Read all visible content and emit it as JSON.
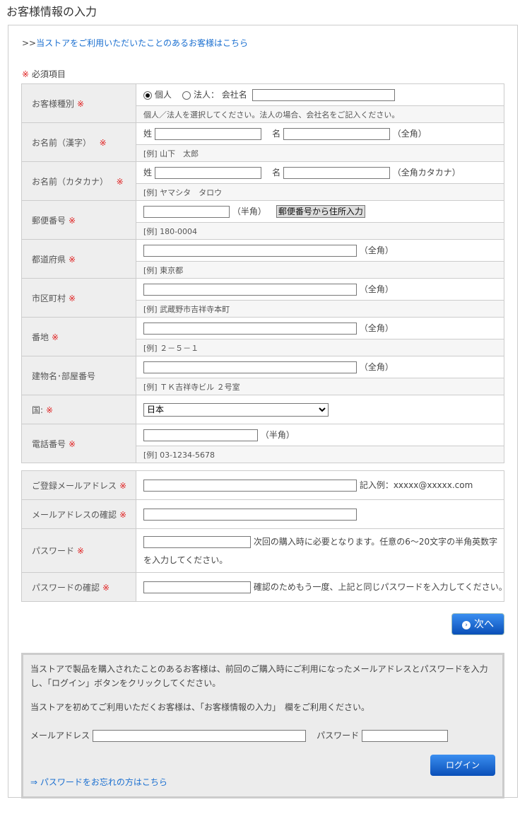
{
  "page_title": "お客様情報の入力",
  "returning_link_prefix": ">>",
  "returning_link": "当ストアをご利用いただいたことのあるお客様はこちら",
  "required_mark": "※",
  "required_note": "必須項目",
  "customer_form": {
    "type": {
      "label": "お客様種別",
      "opt_individual": "個人",
      "opt_corporate": "法人：",
      "company_label": "会社名",
      "hint": "個人／法人を選択してください。法人の場合、会社名をご記入ください。"
    },
    "name_kanji": {
      "label": "お名前（漢字）",
      "last": "姓",
      "first": "名",
      "note": "（全角）",
      "example": "[例] 山下　太郎"
    },
    "name_kana": {
      "label": "お名前（カタカナ）",
      "last": "姓",
      "first": "名",
      "note": "（全角カタカナ）",
      "example": "[例] ヤマシタ　タロウ"
    },
    "zip": {
      "label": "郵便番号",
      "note": "（半角）",
      "button": "郵便番号から住所入力",
      "example": "[例] 180-0004"
    },
    "prefecture": {
      "label": "都道府県",
      "note": "（全角）",
      "example": "[例] 東京都"
    },
    "city": {
      "label": "市区町村",
      "note": "（全角）",
      "example": "[例] 武蔵野市吉祥寺本町"
    },
    "street": {
      "label": "番地",
      "note": "（全角）",
      "example": "[例] ２－５－１"
    },
    "building": {
      "label": "建物名･部屋番号",
      "note": "（全角）",
      "example": "[例] ＴＫ吉祥寺ビル ２号室"
    },
    "country": {
      "label": "国:",
      "selected": "日本"
    },
    "phone": {
      "label": "電話番号",
      "note": "（半角）",
      "example": "[例] 03-1234-5678"
    }
  },
  "account_form": {
    "email": {
      "label": "ご登録メールアドレス",
      "note": "記入例：xxxxx@xxxxx.com"
    },
    "email_confirm": {
      "label": "メールアドレスの確認"
    },
    "password": {
      "label": "パスワード",
      "note": "次回の購入時に必要となります。任意の6～20文字の半角英数字を入力してください。"
    },
    "password_confirm": {
      "label": "パスワードの確認",
      "note": "確認のためもう一度、上記と同じパスワードを入力してください。"
    }
  },
  "next_button": "次へ",
  "login_box": {
    "text1": "当ストアで製品を購入されたことのあるお客様は、前回のご購入時にご利用になったメールアドレスとパスワードを入力し、「ログイン」ボタンをクリックしてください。",
    "text2": "当ストアを初めてご利用いただくお客様は、「お客様情報の入力」　欄をご利用ください。",
    "email_label": "メールアドレス",
    "password_label": "パスワード",
    "login_button": "ログイン",
    "forgot_link": "⇒ パスワードをお忘れの方はこちら"
  }
}
